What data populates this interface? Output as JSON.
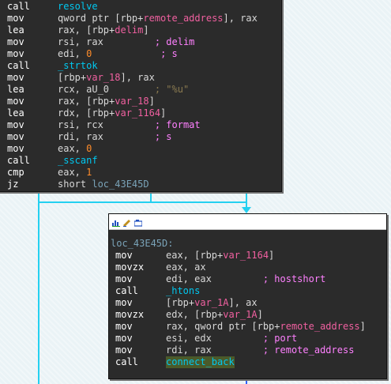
{
  "colors": {
    "background": "#eaf3f6",
    "block_bg": "#2b2b2b",
    "edge": "#24d0f0",
    "function": "#00c8f0",
    "variable": "#f060a0",
    "number": "#ff8c2a",
    "comment": "#ff80ff"
  },
  "top_block": {
    "lines": [
      {
        "mnemonic": "call",
        "parts": [
          {
            "t": "resolve",
            "c": "fn"
          }
        ]
      },
      {
        "mnemonic": "mov",
        "parts": [
          {
            "t": "qword ptr [rbp+",
            "c": "ops"
          },
          {
            "t": "remote_address",
            "c": "var"
          },
          {
            "t": "], rax",
            "c": "ops"
          }
        ]
      },
      {
        "mnemonic": "lea",
        "parts": [
          {
            "t": "rax, [rbp+",
            "c": "ops"
          },
          {
            "t": "delim",
            "c": "var"
          },
          {
            "t": "]",
            "c": "ops"
          }
        ]
      },
      {
        "mnemonic": "mov",
        "parts": [
          {
            "t": "rsi, rax         ",
            "c": "ops"
          },
          {
            "t": "; delim",
            "c": "cmt"
          }
        ]
      },
      {
        "mnemonic": "mov",
        "parts": [
          {
            "t": "edi, ",
            "c": "ops"
          },
          {
            "t": "0",
            "c": "num"
          },
          {
            "t": "            ",
            "c": "ops"
          },
          {
            "t": "; s",
            "c": "cmt"
          }
        ]
      },
      {
        "mnemonic": "call",
        "parts": [
          {
            "t": "_strtok",
            "c": "fn"
          }
        ]
      },
      {
        "mnemonic": "mov",
        "parts": [
          {
            "t": "[rbp+",
            "c": "ops"
          },
          {
            "t": "var_18",
            "c": "var"
          },
          {
            "t": "], rax",
            "c": "ops"
          }
        ]
      },
      {
        "mnemonic": "lea",
        "parts": [
          {
            "t": "rcx, aU_0        ",
            "c": "ops"
          },
          {
            "t": "; \"%u\"",
            "c": "dim"
          }
        ]
      },
      {
        "mnemonic": "mov",
        "parts": [
          {
            "t": "rax, [rbp+",
            "c": "ops"
          },
          {
            "t": "var_18",
            "c": "var"
          },
          {
            "t": "]",
            "c": "ops"
          }
        ]
      },
      {
        "mnemonic": "lea",
        "parts": [
          {
            "t": "rdx, [rbp+",
            "c": "ops"
          },
          {
            "t": "var_1164",
            "c": "var"
          },
          {
            "t": "]",
            "c": "ops"
          }
        ]
      },
      {
        "mnemonic": "mov",
        "parts": [
          {
            "t": "rsi, rcx         ",
            "c": "ops"
          },
          {
            "t": "; format",
            "c": "cmt"
          }
        ]
      },
      {
        "mnemonic": "mov",
        "parts": [
          {
            "t": "rdi, rax         ",
            "c": "ops"
          },
          {
            "t": "; s",
            "c": "cmt"
          }
        ]
      },
      {
        "mnemonic": "mov",
        "parts": [
          {
            "t": "eax, ",
            "c": "ops"
          },
          {
            "t": "0",
            "c": "num"
          }
        ]
      },
      {
        "mnemonic": "call",
        "parts": [
          {
            "t": "_sscanf",
            "c": "fn"
          }
        ]
      },
      {
        "mnemonic": "cmp",
        "parts": [
          {
            "t": "eax, ",
            "c": "ops"
          },
          {
            "t": "1",
            "c": "num"
          }
        ]
      },
      {
        "mnemonic": "jz",
        "parts": [
          {
            "t": "short ",
            "c": "ops"
          },
          {
            "t": "loc_43E45D",
            "c": "lbl"
          }
        ]
      }
    ]
  },
  "bottom_block": {
    "label": "loc_43E45D:",
    "lines": [
      {
        "mnemonic": "mov",
        "parts": [
          {
            "t": "eax, [rbp+",
            "c": "ops"
          },
          {
            "t": "var_1164",
            "c": "var"
          },
          {
            "t": "]",
            "c": "ops"
          }
        ]
      },
      {
        "mnemonic": "movzx",
        "parts": [
          {
            "t": "eax, ax",
            "c": "ops"
          }
        ]
      },
      {
        "mnemonic": "mov",
        "parts": [
          {
            "t": "edi, eax         ",
            "c": "ops"
          },
          {
            "t": "; hostshort",
            "c": "cmt"
          }
        ]
      },
      {
        "mnemonic": "call",
        "parts": [
          {
            "t": "_htons",
            "c": "fn"
          }
        ]
      },
      {
        "mnemonic": "mov",
        "parts": [
          {
            "t": "[rbp+",
            "c": "ops"
          },
          {
            "t": "var_1A",
            "c": "var"
          },
          {
            "t": "], ax",
            "c": "ops"
          }
        ]
      },
      {
        "mnemonic": "movzx",
        "parts": [
          {
            "t": "edx, [rbp+",
            "c": "ops"
          },
          {
            "t": "var_1A",
            "c": "var"
          },
          {
            "t": "]",
            "c": "ops"
          }
        ]
      },
      {
        "mnemonic": "mov",
        "parts": [
          {
            "t": "rax, qword ptr [rbp+",
            "c": "ops"
          },
          {
            "t": "remote_address",
            "c": "var"
          },
          {
            "t": "]",
            "c": "ops"
          }
        ]
      },
      {
        "mnemonic": "mov",
        "parts": [
          {
            "t": "esi, edx         ",
            "c": "ops"
          },
          {
            "t": "; port",
            "c": "cmt"
          }
        ]
      },
      {
        "mnemonic": "mov",
        "parts": [
          {
            "t": "rdi, rax         ",
            "c": "ops"
          },
          {
            "t": "; remote_address",
            "c": "cmt"
          }
        ]
      },
      {
        "mnemonic": "call",
        "parts": [
          {
            "t": "connect_back",
            "c": "fn sel"
          }
        ]
      }
    ]
  }
}
